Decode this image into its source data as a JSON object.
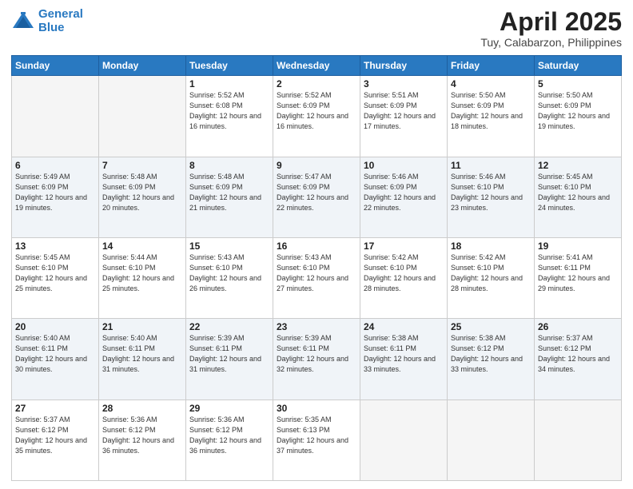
{
  "logo": {
    "line1": "General",
    "line2": "Blue"
  },
  "title": "April 2025",
  "subtitle": "Tuy, Calabarzon, Philippines",
  "days_of_week": [
    "Sunday",
    "Monday",
    "Tuesday",
    "Wednesday",
    "Thursday",
    "Friday",
    "Saturday"
  ],
  "weeks": [
    [
      {
        "day": "",
        "sunrise": "",
        "sunset": "",
        "daylight": "",
        "empty": true
      },
      {
        "day": "",
        "sunrise": "",
        "sunset": "",
        "daylight": "",
        "empty": true
      },
      {
        "day": "1",
        "sunrise": "Sunrise: 5:52 AM",
        "sunset": "Sunset: 6:08 PM",
        "daylight": "Daylight: 12 hours and 16 minutes."
      },
      {
        "day": "2",
        "sunrise": "Sunrise: 5:52 AM",
        "sunset": "Sunset: 6:09 PM",
        "daylight": "Daylight: 12 hours and 16 minutes."
      },
      {
        "day": "3",
        "sunrise": "Sunrise: 5:51 AM",
        "sunset": "Sunset: 6:09 PM",
        "daylight": "Daylight: 12 hours and 17 minutes."
      },
      {
        "day": "4",
        "sunrise": "Sunrise: 5:50 AM",
        "sunset": "Sunset: 6:09 PM",
        "daylight": "Daylight: 12 hours and 18 minutes."
      },
      {
        "day": "5",
        "sunrise": "Sunrise: 5:50 AM",
        "sunset": "Sunset: 6:09 PM",
        "daylight": "Daylight: 12 hours and 19 minutes."
      }
    ],
    [
      {
        "day": "6",
        "sunrise": "Sunrise: 5:49 AM",
        "sunset": "Sunset: 6:09 PM",
        "daylight": "Daylight: 12 hours and 19 minutes."
      },
      {
        "day": "7",
        "sunrise": "Sunrise: 5:48 AM",
        "sunset": "Sunset: 6:09 PM",
        "daylight": "Daylight: 12 hours and 20 minutes."
      },
      {
        "day": "8",
        "sunrise": "Sunrise: 5:48 AM",
        "sunset": "Sunset: 6:09 PM",
        "daylight": "Daylight: 12 hours and 21 minutes."
      },
      {
        "day": "9",
        "sunrise": "Sunrise: 5:47 AM",
        "sunset": "Sunset: 6:09 PM",
        "daylight": "Daylight: 12 hours and 22 minutes."
      },
      {
        "day": "10",
        "sunrise": "Sunrise: 5:46 AM",
        "sunset": "Sunset: 6:09 PM",
        "daylight": "Daylight: 12 hours and 22 minutes."
      },
      {
        "day": "11",
        "sunrise": "Sunrise: 5:46 AM",
        "sunset": "Sunset: 6:10 PM",
        "daylight": "Daylight: 12 hours and 23 minutes."
      },
      {
        "day": "12",
        "sunrise": "Sunrise: 5:45 AM",
        "sunset": "Sunset: 6:10 PM",
        "daylight": "Daylight: 12 hours and 24 minutes."
      }
    ],
    [
      {
        "day": "13",
        "sunrise": "Sunrise: 5:45 AM",
        "sunset": "Sunset: 6:10 PM",
        "daylight": "Daylight: 12 hours and 25 minutes."
      },
      {
        "day": "14",
        "sunrise": "Sunrise: 5:44 AM",
        "sunset": "Sunset: 6:10 PM",
        "daylight": "Daylight: 12 hours and 25 minutes."
      },
      {
        "day": "15",
        "sunrise": "Sunrise: 5:43 AM",
        "sunset": "Sunset: 6:10 PM",
        "daylight": "Daylight: 12 hours and 26 minutes."
      },
      {
        "day": "16",
        "sunrise": "Sunrise: 5:43 AM",
        "sunset": "Sunset: 6:10 PM",
        "daylight": "Daylight: 12 hours and 27 minutes."
      },
      {
        "day": "17",
        "sunrise": "Sunrise: 5:42 AM",
        "sunset": "Sunset: 6:10 PM",
        "daylight": "Daylight: 12 hours and 28 minutes."
      },
      {
        "day": "18",
        "sunrise": "Sunrise: 5:42 AM",
        "sunset": "Sunset: 6:10 PM",
        "daylight": "Daylight: 12 hours and 28 minutes."
      },
      {
        "day": "19",
        "sunrise": "Sunrise: 5:41 AM",
        "sunset": "Sunset: 6:11 PM",
        "daylight": "Daylight: 12 hours and 29 minutes."
      }
    ],
    [
      {
        "day": "20",
        "sunrise": "Sunrise: 5:40 AM",
        "sunset": "Sunset: 6:11 PM",
        "daylight": "Daylight: 12 hours and 30 minutes."
      },
      {
        "day": "21",
        "sunrise": "Sunrise: 5:40 AM",
        "sunset": "Sunset: 6:11 PM",
        "daylight": "Daylight: 12 hours and 31 minutes."
      },
      {
        "day": "22",
        "sunrise": "Sunrise: 5:39 AM",
        "sunset": "Sunset: 6:11 PM",
        "daylight": "Daylight: 12 hours and 31 minutes."
      },
      {
        "day": "23",
        "sunrise": "Sunrise: 5:39 AM",
        "sunset": "Sunset: 6:11 PM",
        "daylight": "Daylight: 12 hours and 32 minutes."
      },
      {
        "day": "24",
        "sunrise": "Sunrise: 5:38 AM",
        "sunset": "Sunset: 6:11 PM",
        "daylight": "Daylight: 12 hours and 33 minutes."
      },
      {
        "day": "25",
        "sunrise": "Sunrise: 5:38 AM",
        "sunset": "Sunset: 6:12 PM",
        "daylight": "Daylight: 12 hours and 33 minutes."
      },
      {
        "day": "26",
        "sunrise": "Sunrise: 5:37 AM",
        "sunset": "Sunset: 6:12 PM",
        "daylight": "Daylight: 12 hours and 34 minutes."
      }
    ],
    [
      {
        "day": "27",
        "sunrise": "Sunrise: 5:37 AM",
        "sunset": "Sunset: 6:12 PM",
        "daylight": "Daylight: 12 hours and 35 minutes."
      },
      {
        "day": "28",
        "sunrise": "Sunrise: 5:36 AM",
        "sunset": "Sunset: 6:12 PM",
        "daylight": "Daylight: 12 hours and 36 minutes."
      },
      {
        "day": "29",
        "sunrise": "Sunrise: 5:36 AM",
        "sunset": "Sunset: 6:12 PM",
        "daylight": "Daylight: 12 hours and 36 minutes."
      },
      {
        "day": "30",
        "sunrise": "Sunrise: 5:35 AM",
        "sunset": "Sunset: 6:13 PM",
        "daylight": "Daylight: 12 hours and 37 minutes."
      },
      {
        "day": "",
        "sunrise": "",
        "sunset": "",
        "daylight": "",
        "empty": true
      },
      {
        "day": "",
        "sunrise": "",
        "sunset": "",
        "daylight": "",
        "empty": true
      },
      {
        "day": "",
        "sunrise": "",
        "sunset": "",
        "daylight": "",
        "empty": true
      }
    ]
  ]
}
